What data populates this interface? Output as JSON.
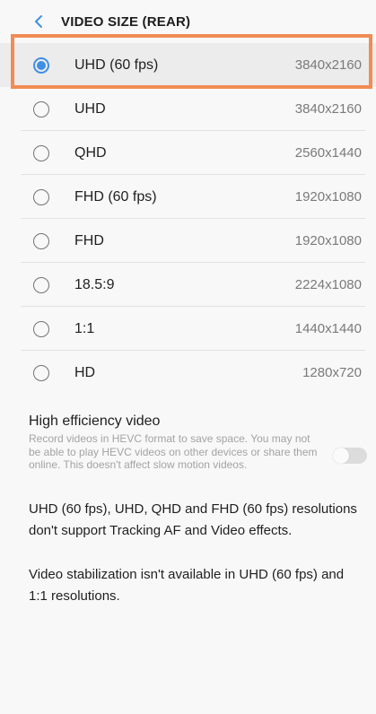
{
  "header": {
    "title": "VIDEO SIZE (REAR)",
    "back_icon": "chevron-left-icon"
  },
  "options": [
    {
      "label": "UHD (60 fps)",
      "resolution": "3840x2160",
      "selected": true
    },
    {
      "label": "UHD",
      "resolution": "3840x2160",
      "selected": false
    },
    {
      "label": "QHD",
      "resolution": "2560x1440",
      "selected": false
    },
    {
      "label": "FHD (60 fps)",
      "resolution": "1920x1080",
      "selected": false
    },
    {
      "label": "FHD",
      "resolution": "1920x1080",
      "selected": false
    },
    {
      "label": "18.5:9",
      "resolution": "2224x1080",
      "selected": false
    },
    {
      "label": "1:1",
      "resolution": "1440x1440",
      "selected": false
    },
    {
      "label": "HD",
      "resolution": "1280x720",
      "selected": false
    }
  ],
  "hevc": {
    "title": "High efficiency video",
    "description": "Record videos in HEVC format to save space. You may not be able to play HEVC videos on other devices or share them online. This doesn't affect slow motion videos.",
    "enabled": false
  },
  "notes": {
    "tracking": "UHD (60 fps), UHD, QHD and FHD (60 fps) resolutions don't support Tracking AF and Video effects.",
    "stabilization": "Video stabilization isn't available in UHD (60 fps) and 1:1 resolutions."
  },
  "colors": {
    "accent": "#3e8fe6",
    "highlight_border": "#f28c54"
  }
}
